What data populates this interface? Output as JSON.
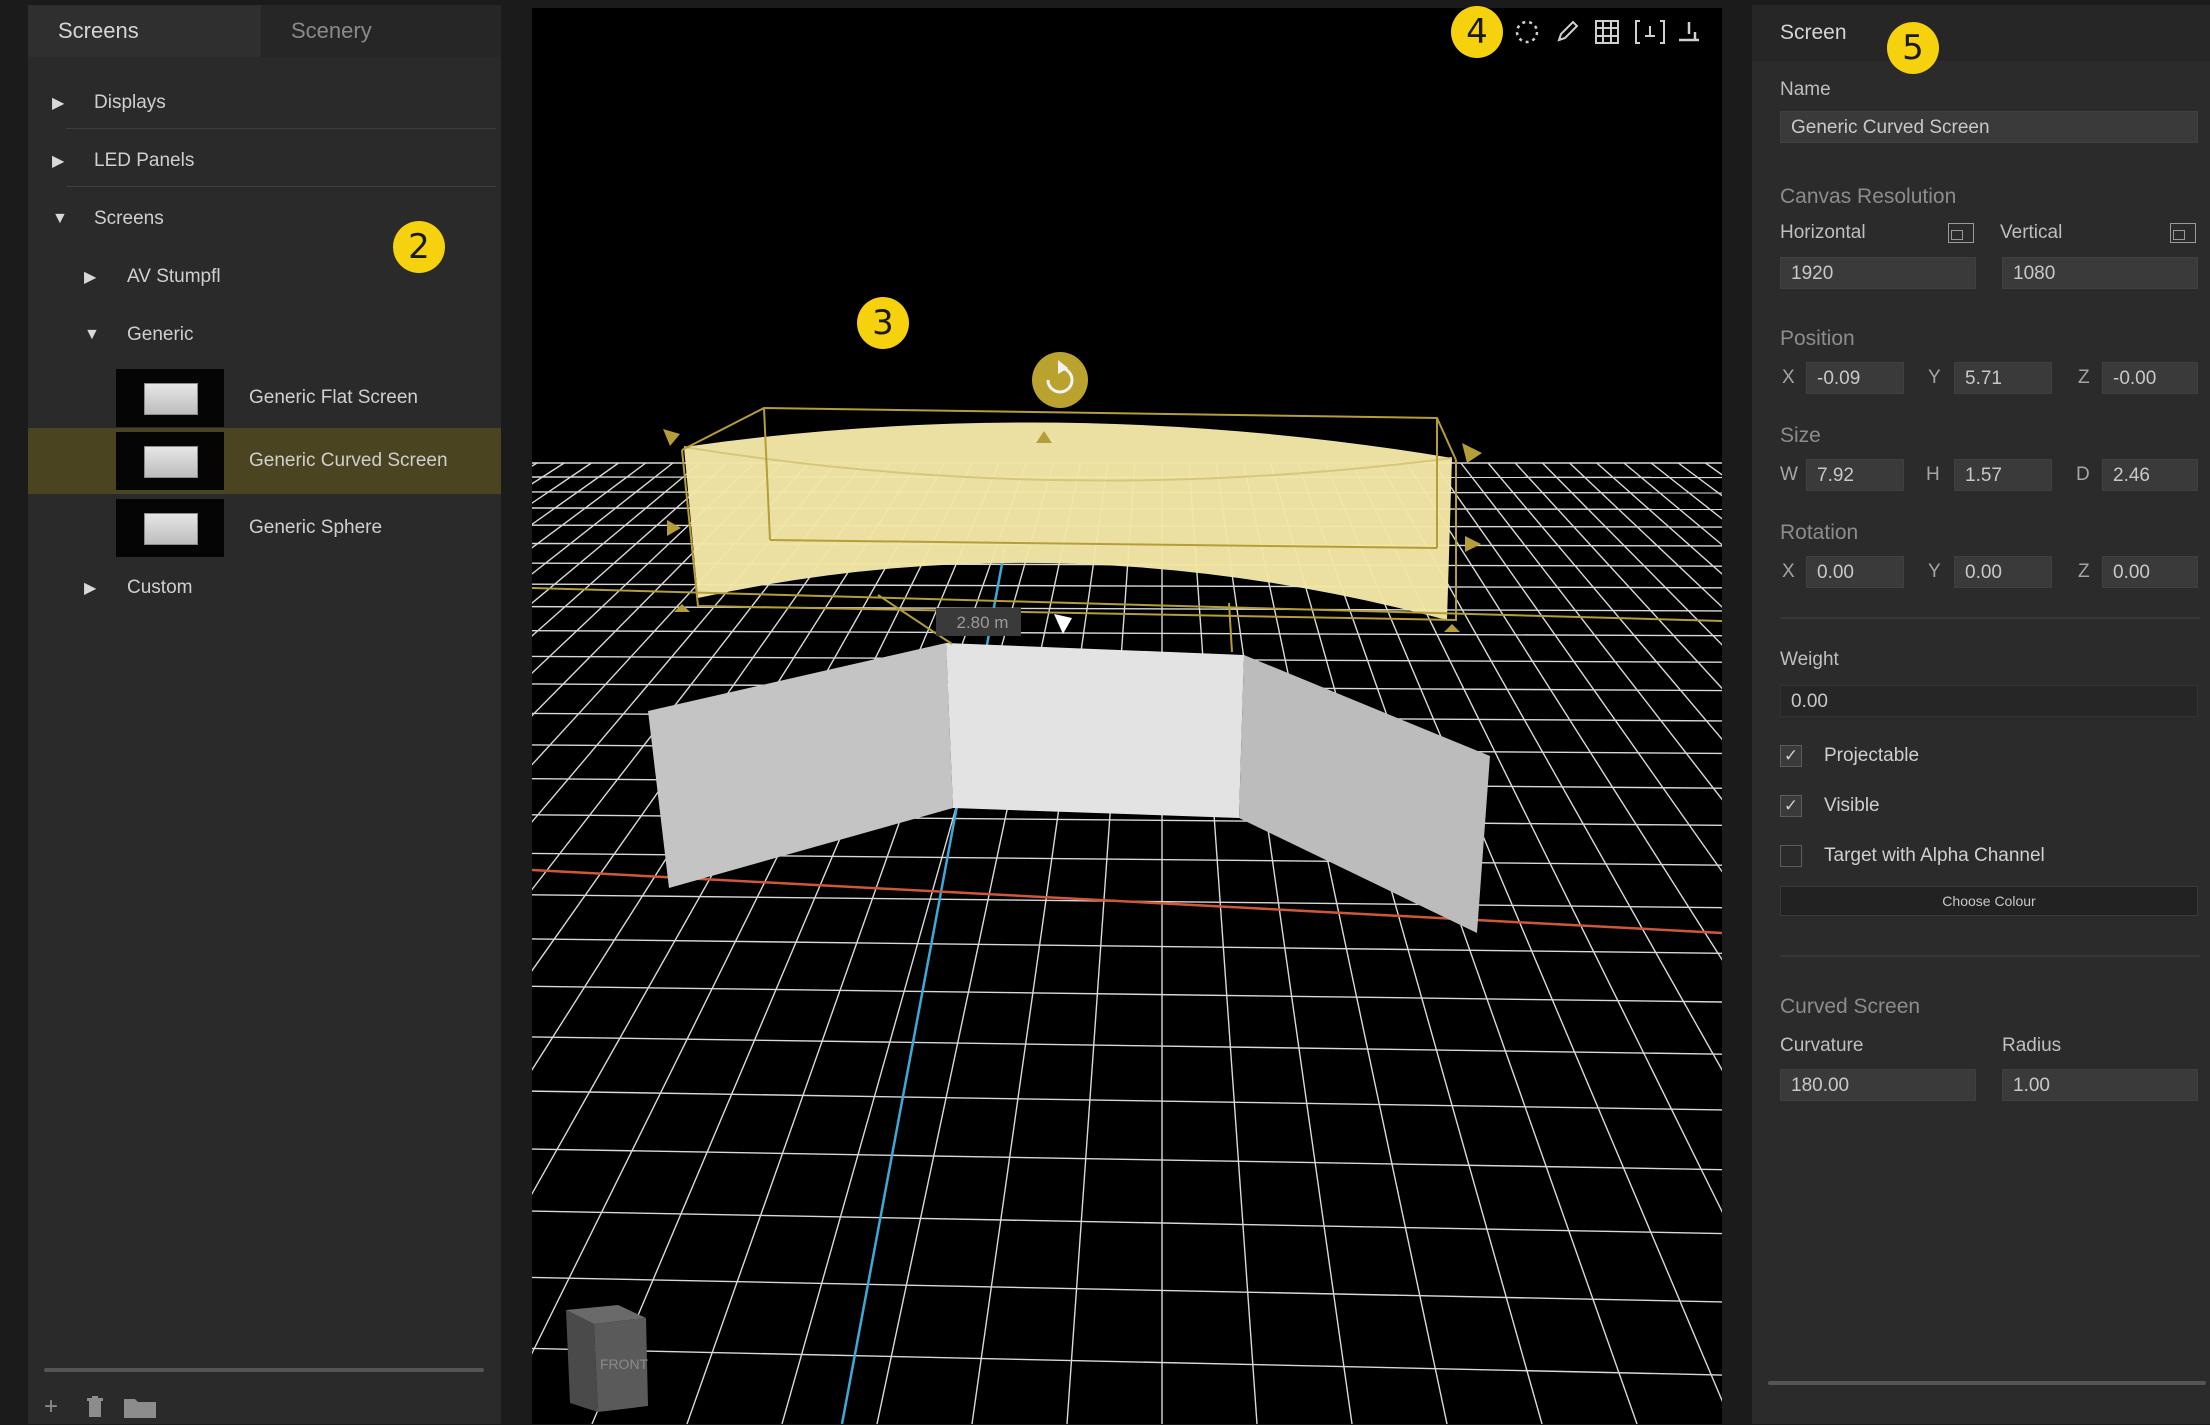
{
  "left_panel": {
    "tabs": [
      {
        "label": "Screens"
      },
      {
        "label": "Scenery"
      }
    ],
    "tree": {
      "displays": "Displays",
      "led_panels": "LED Panels",
      "screens": "Screens",
      "av_stumpfl": "AV Stumpfl",
      "generic": "Generic",
      "items": [
        {
          "label": "Generic Flat Screen"
        },
        {
          "label": "Generic Curved Screen"
        },
        {
          "label": "Generic Sphere"
        }
      ],
      "custom": "Custom"
    }
  },
  "viewport": {
    "dimension_label": "2.80 m",
    "view_cube_label": "FRONT"
  },
  "callouts": [
    "2",
    "3",
    "4",
    "5"
  ],
  "right_panel": {
    "title": "Screen",
    "name_label": "Name",
    "name_value": "Generic Curved Screen",
    "canvas_resolution": {
      "heading": "Canvas Resolution",
      "horizontal_label": "Horizontal",
      "vertical_label": "Vertical",
      "horizontal_value": "1920",
      "vertical_value": "1080"
    },
    "position": {
      "heading": "Position",
      "x": "-0.09",
      "y": "5.71",
      "z": "-0.00"
    },
    "size": {
      "heading": "Size",
      "w": "7.92",
      "h": "1.57",
      "d": "2.46"
    },
    "rotation": {
      "heading": "Rotation",
      "x": "0.00",
      "y": "0.00",
      "z": "0.00"
    },
    "axes": {
      "x": "X",
      "y": "Y",
      "z": "Z",
      "w": "W",
      "h": "H",
      "d": "D"
    },
    "weight": {
      "label": "Weight",
      "value": "0.00"
    },
    "checkboxes": [
      {
        "label": "Projectable",
        "checked": true
      },
      {
        "label": "Visible",
        "checked": true
      },
      {
        "label": "Target with Alpha Channel",
        "checked": false
      }
    ],
    "choose_colour": "Choose Colour",
    "curved_screen": {
      "heading": "Curved Screen",
      "curvature_label": "Curvature",
      "radius_label": "Radius",
      "curvature_value": "180.00",
      "radius_value": "1.00"
    }
  },
  "colors": {
    "accent_yellow": "#f5d20d",
    "selection": "#4a4420",
    "grid": "#d9d9d9",
    "axis_blue": "#3fa9d6",
    "axis_red": "#d0573c",
    "curved_screen_fill": "#f3e7a6"
  }
}
